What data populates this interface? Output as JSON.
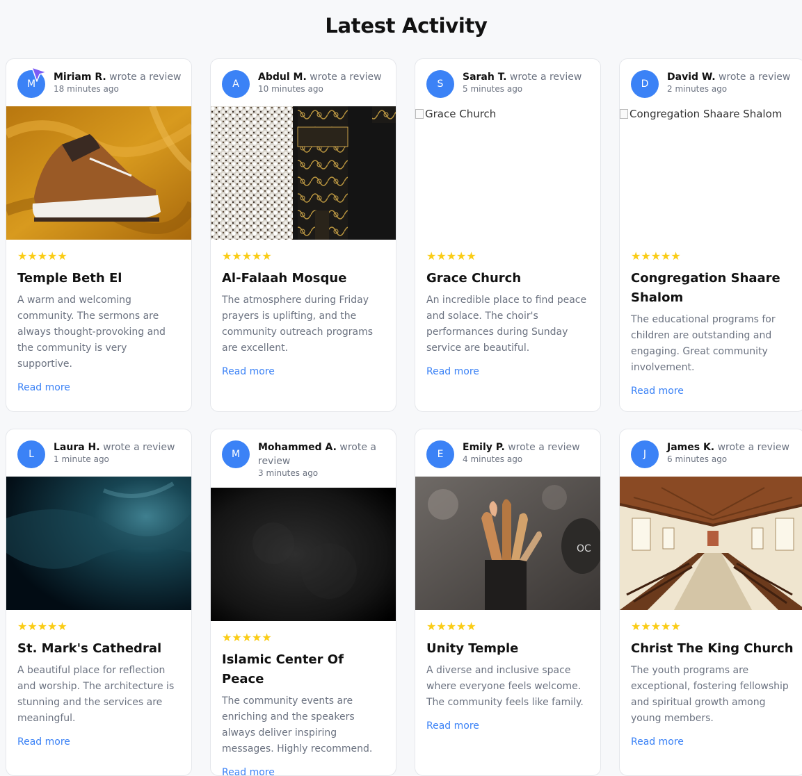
{
  "page": {
    "title": "Latest Activity"
  },
  "colors": {
    "accent": "#3b82f6",
    "star": "#facc15",
    "muted": "#6b7280"
  },
  "action_label": "wrote a review",
  "stars_glyph": "★★★★★",
  "link_label": "Read more",
  "cards": [
    {
      "initial": "M",
      "user": "Miriam R.",
      "time": "18 minutes ago",
      "rating": 5,
      "title": "Temple Beth El",
      "text": "A warm and welcoming community. The sermons are always thought-provoking and the community is very supportive.",
      "image": "sneaker-photo"
    },
    {
      "initial": "A",
      "user": "Abdul M.",
      "time": "10 minutes ago",
      "rating": 5,
      "title": "Al-Falaah Mosque",
      "text": "The atmosphere during Friday prayers is uplifting, and the community outreach programs are excellent.",
      "image": "kaaba-photo"
    },
    {
      "initial": "S",
      "user": "Sarah T.",
      "time": "5 minutes ago",
      "rating": 5,
      "title": "Grace Church",
      "text": "An incredible place to find peace and solace. The choir's performances during Sunday service are beautiful.",
      "image_alt": "Grace Church"
    },
    {
      "initial": "D",
      "user": "David W.",
      "time": "2 minutes ago",
      "rating": 5,
      "title": "Congregation Shaare Shalom",
      "text": "The educational programs for children are outstanding and engaging. Great community involvement.",
      "image_alt": "Congregation Shaare Shalom"
    },
    {
      "initial": "L",
      "user": "Laura H.",
      "time": "1 minute ago",
      "rating": 5,
      "title": "St. Mark's Cathedral",
      "text": "A beautiful place for reflection and worship. The architecture is stunning and the services are meaningful.",
      "image": "dark-sky-photo"
    },
    {
      "initial": "M",
      "user": "Mohammed A.",
      "time": "3 minutes ago",
      "rating": 5,
      "title": "Islamic Center Of Peace",
      "text": "The community events are enriching and the speakers always deliver inspiring messages. Highly recommend.",
      "image": "dark-texture-photo"
    },
    {
      "initial": "E",
      "user": "Emily P.",
      "time": "4 minutes ago",
      "rating": 5,
      "title": "Unity Temple",
      "text": "A diverse and inclusive space where everyone feels welcome. The community feels like family.",
      "image": "makeup-brushes-photo"
    },
    {
      "initial": "J",
      "user": "James K.",
      "time": "6 minutes ago",
      "rating": 5,
      "title": "Christ The King Church",
      "text": "The youth programs are exceptional, fostering fellowship and spiritual growth among young members.",
      "image": "church-interior-photo"
    }
  ]
}
